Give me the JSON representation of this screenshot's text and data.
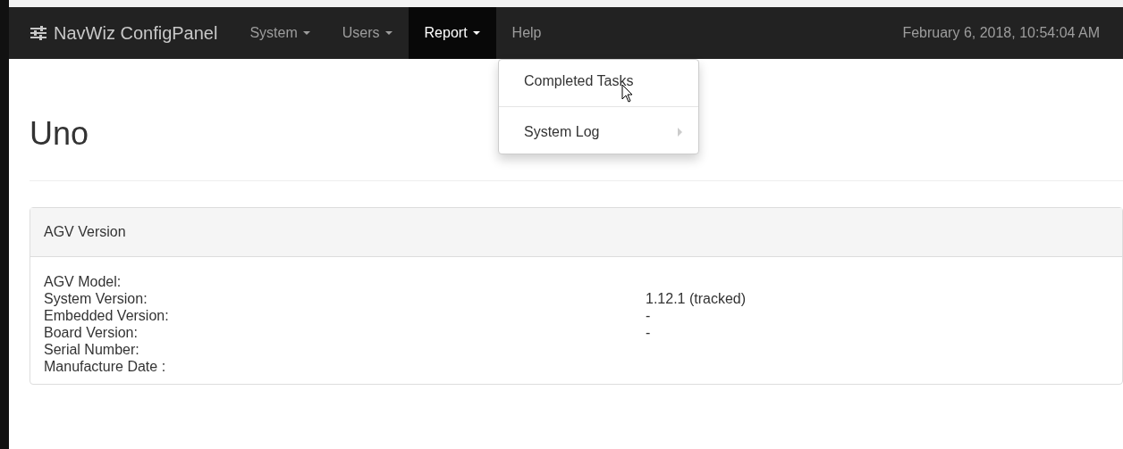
{
  "navbar": {
    "brand": "NavWiz ConfigPanel",
    "menus": [
      {
        "label": "System",
        "caret": true,
        "selected": false
      },
      {
        "label": "Users",
        "caret": true,
        "selected": false
      },
      {
        "label": "Report",
        "caret": true,
        "selected": true
      },
      {
        "label": "Help",
        "caret": false,
        "selected": false
      }
    ],
    "datetime": "February 6, 2018, 10:54:04 AM"
  },
  "dropdown": {
    "items": [
      {
        "label": "Completed Tasks",
        "submenu": false,
        "hovered": true
      },
      {
        "label": "System Log",
        "submenu": true,
        "hovered": false
      }
    ]
  },
  "page": {
    "title": "Uno"
  },
  "panel": {
    "heading": "AGV Version",
    "rows": [
      {
        "label": "AGV Model:",
        "value": ""
      },
      {
        "label": "System Version:",
        "value": "1.12.1 (tracked)"
      },
      {
        "label": "Embedded Version:",
        "value": "-"
      },
      {
        "label": "Board Version:",
        "value": "-"
      },
      {
        "label": "Serial Number:",
        "value": ""
      },
      {
        "label": "Manufacture Date :",
        "value": ""
      }
    ]
  }
}
